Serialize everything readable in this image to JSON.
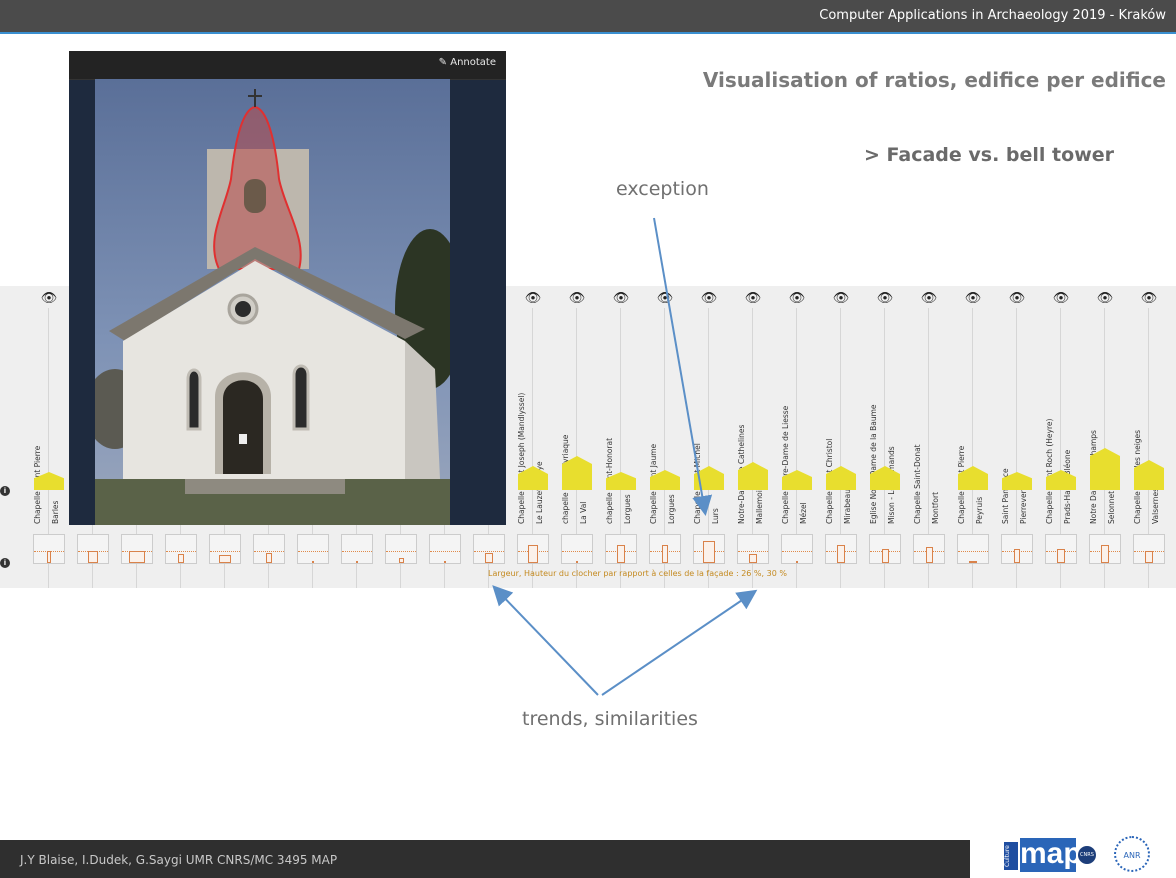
{
  "header": {
    "conference": "Computer Applications in Archaeology  2019 - Kraków"
  },
  "slide": {
    "title": "Visualisation of ratios, edifice per edifice",
    "subtitle": "> Facade vs. bell tower",
    "note_exception": "exception",
    "note_trends": "trends, similarities"
  },
  "photo_panel": {
    "annotate_label": "Annotate"
  },
  "viz": {
    "caption": "Largeur, Hauteur du clocher par rapport à celles de la façade : 26 %, 30 %",
    "info_glyph": "i",
    "eye_glyph": "👁",
    "columns": [
      {
        "label": "Chapelle Saint Pierre",
        "location": "Barles",
        "facade_w": 30,
        "facade_h": 18,
        "bell_w": 4,
        "bell_h": 12
      },
      {
        "label": "",
        "location": "",
        "facade_w": 0,
        "facade_h": 0,
        "bell_w": 10,
        "bell_h": 12
      },
      {
        "label": "",
        "location": "",
        "facade_w": 0,
        "facade_h": 0,
        "bell_w": 16,
        "bell_h": 12
      },
      {
        "label": "",
        "location": "",
        "facade_w": 0,
        "facade_h": 0,
        "bell_w": 6,
        "bell_h": 9
      },
      {
        "label": "",
        "location": "",
        "facade_w": 0,
        "facade_h": 0,
        "bell_w": 12,
        "bell_h": 8
      },
      {
        "label": "",
        "location": "",
        "facade_w": 0,
        "facade_h": 0,
        "bell_w": 6,
        "bell_h": 10
      },
      {
        "label": "",
        "location": "",
        "facade_w": 0,
        "facade_h": 0,
        "bell_w": 2,
        "bell_h": 2
      },
      {
        "label": "",
        "location": "",
        "facade_w": 0,
        "facade_h": 0,
        "bell_w": 2,
        "bell_h": 2
      },
      {
        "label": "",
        "location": "",
        "facade_w": 0,
        "facade_h": 0,
        "bell_w": 5,
        "bell_h": 5
      },
      {
        "label": "",
        "location": "",
        "facade_w": 0,
        "facade_h": 0,
        "bell_w": 2,
        "bell_h": 2
      },
      {
        "label": "",
        "location": "",
        "facade_w": 0,
        "facade_h": 0,
        "bell_w": 8,
        "bell_h": 10
      },
      {
        "label": "Chapelle Saint Joseph (Mandlyssel)",
        "location": "Le Lauzet-Ubaye",
        "facade_w": 30,
        "facade_h": 24,
        "bell_w": 10,
        "bell_h": 18
      },
      {
        "label": "chapelle Saint-Cyriaque",
        "location": "La Val",
        "facade_w": 30,
        "facade_h": 34,
        "bell_w": 2,
        "bell_h": 2
      },
      {
        "label": "chapelle Saint-Honorat",
        "location": "Lorgues",
        "facade_w": 30,
        "facade_h": 18,
        "bell_w": 8,
        "bell_h": 18
      },
      {
        "label": "Chapelle Saint Jaume",
        "location": "Lorgues",
        "facade_w": 30,
        "facade_h": 20,
        "bell_w": 6,
        "bell_h": 18
      },
      {
        "label": "Chapelle Saint Michel",
        "location": "Lurs",
        "facade_w": 30,
        "facade_h": 24,
        "bell_w": 12,
        "bell_h": 22
      },
      {
        "label": "Notre-Dame de Cathelines",
        "location": "Mallemoisson",
        "facade_w": 30,
        "facade_h": 28,
        "bell_w": 8,
        "bell_h": 9
      },
      {
        "label": "Chapelle Notre-Dame de Liesse",
        "location": "Mézel",
        "facade_w": 30,
        "facade_h": 20,
        "bell_w": 2,
        "bell_h": 2
      },
      {
        "label": "Chapelle Saint Christol",
        "location": "Mirabeau",
        "facade_w": 30,
        "facade_h": 24,
        "bell_w": 8,
        "bell_h": 18
      },
      {
        "label": "Eglise Notre Dame de la Baume",
        "location": "Mison - Les Armands",
        "facade_w": 30,
        "facade_h": 24,
        "bell_w": 7,
        "bell_h": 14
      },
      {
        "label": "Chapelle Saint-Donat",
        "location": "Montfort",
        "facade_w": 0,
        "facade_h": 0,
        "bell_w": 7,
        "bell_h": 16
      },
      {
        "label": "Chapelle Saint Pierre",
        "location": "Peyruis",
        "facade_w": 30,
        "facade_h": 24,
        "bell_w": 8,
        "bell_h": 2
      },
      {
        "label": "Saint Pancrace",
        "location": "Pierrevert",
        "facade_w": 30,
        "facade_h": 18,
        "bell_w": 6,
        "bell_h": 14
      },
      {
        "label": "Chapelle Saint Roch (Heyre)",
        "location": "Prads-Haute-Bléone",
        "facade_w": 30,
        "facade_h": 20,
        "bell_w": 8,
        "bell_h": 14
      },
      {
        "label": "Notre Dame des Champs",
        "location": "Selonnet",
        "facade_w": 30,
        "facade_h": 42,
        "bell_w": 8,
        "bell_h": 18
      },
      {
        "label": "Chapelle N.D. des neiges",
        "location": "Valsernes",
        "facade_w": 30,
        "facade_h": 30,
        "bell_w": 8,
        "bell_h": 12
      }
    ]
  },
  "footer": {
    "authors": "J.Y Blaise, I.Dudek, G.Saygi UMR CNRS/MC 3495 MAP"
  },
  "logos": {
    "culture": "Culture",
    "map": "map",
    "cnrs": "CNRS",
    "anr": "ANR"
  },
  "colors": {
    "facade": "#e8de2e",
    "bell": "#d9824a",
    "arrow": "#5b8fc7"
  }
}
